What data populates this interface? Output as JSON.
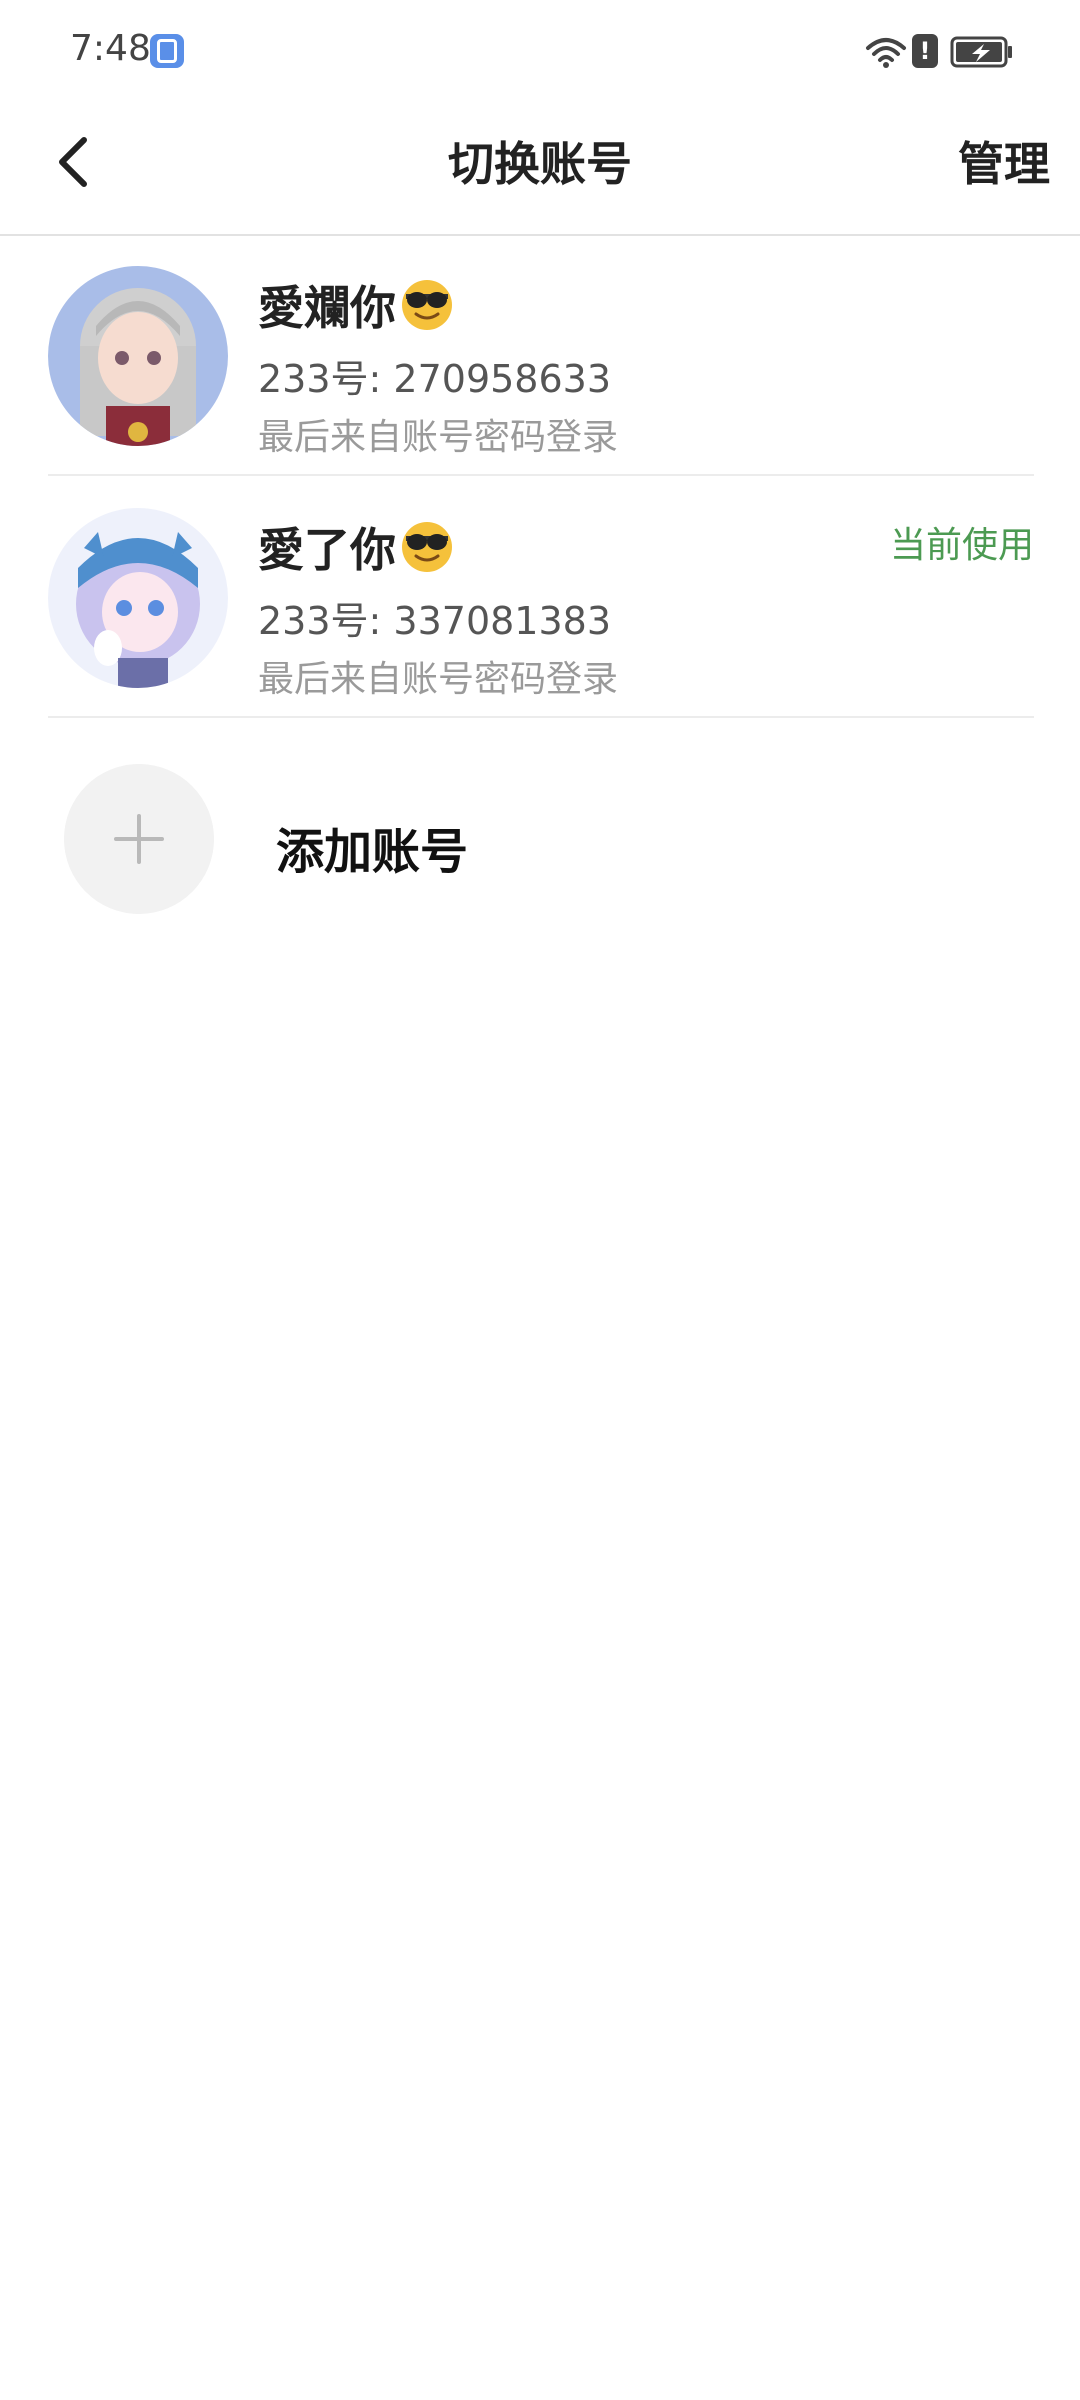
{
  "status_bar": {
    "time": "7:48"
  },
  "header": {
    "title": "切换账号",
    "manage_label": "管理"
  },
  "accounts": [
    {
      "name": "愛斕你",
      "id_line": "233号: 270958633",
      "sub_line": "最后来自账号密码登录",
      "current_label": ""
    },
    {
      "name": "愛了你",
      "id_line": "233号: 337081383",
      "sub_line": "最后来自账号密码登录",
      "current_label": "当前使用"
    }
  ],
  "add_account": {
    "label": "添加账号"
  },
  "colors": {
    "accent_green": "#4c9a52",
    "divider": "#e2e2e2",
    "muted_text": "#9a9a9a"
  }
}
